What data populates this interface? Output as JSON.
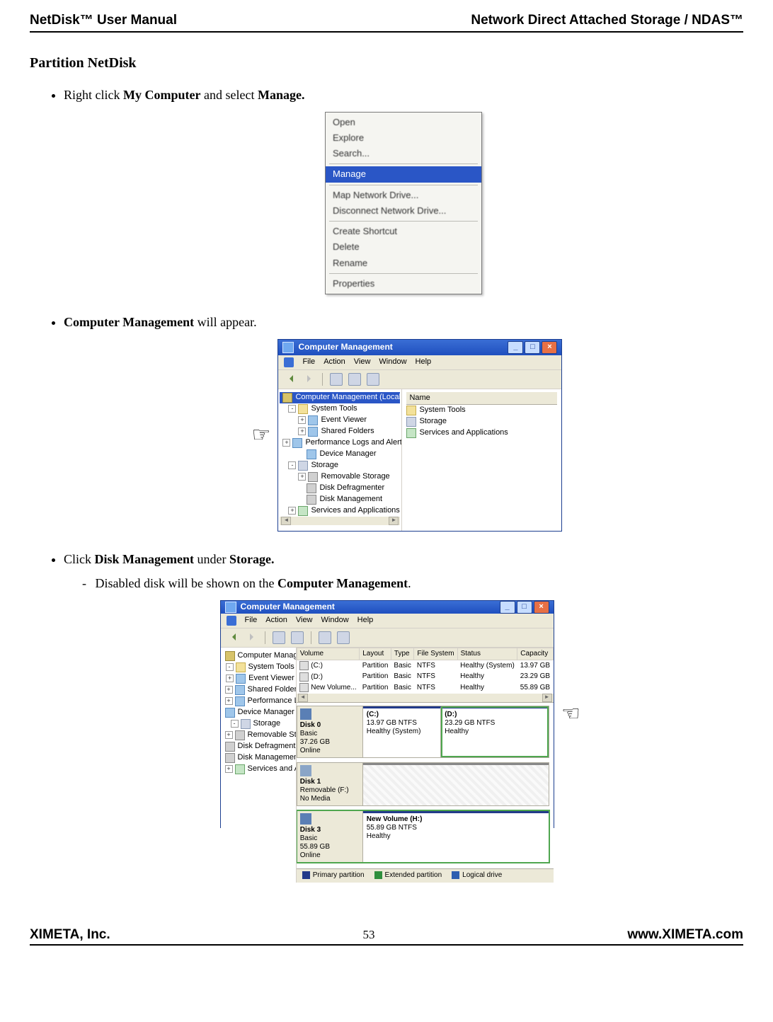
{
  "header": {
    "left": "NetDisk™ User Manual",
    "right": "Network Direct Attached Storage / NDAS™"
  },
  "section_heading": "Partition NetDisk",
  "bullets": {
    "b1_pre": "Right click ",
    "b1_bold1": "My Computer",
    "b1_mid": " and select ",
    "b1_bold2": "Manage.",
    "b2_bold": "Computer Management",
    "b2_post": " will appear.",
    "b3_pre": "Click ",
    "b3_bold1": "Disk Management",
    "b3_mid": " under ",
    "b3_bold2": "Storage.",
    "b3_sub_pre": "Disabled disk will be shown on the ",
    "b3_sub_bold": "Computer Management",
    "b3_sub_post": "."
  },
  "context_menu": {
    "items_top": [
      "Open",
      "Explore",
      "Search..."
    ],
    "selected": "Manage",
    "items_mid": [
      "Map Network Drive...",
      "Disconnect Network Drive..."
    ],
    "items_mid2": [
      "Create Shortcut",
      "Delete",
      "Rename"
    ],
    "items_bot": [
      "Properties"
    ]
  },
  "xp_common": {
    "title": "Computer Management",
    "btn_min": "_",
    "btn_max": "□",
    "btn_close": "×",
    "menus": [
      "File",
      "Action",
      "View",
      "Window",
      "Help"
    ]
  },
  "fig2": {
    "tree_root": "Computer Management (Local)",
    "tree": [
      "System Tools",
      "Event Viewer",
      "Shared Folders",
      "Performance Logs and Alerts",
      "Device Manager",
      "Storage",
      "Removable Storage",
      "Disk Defragmenter",
      "Disk Management",
      "Services and Applications"
    ],
    "list_header": "Name",
    "list": [
      "System Tools",
      "Storage",
      "Services and Applications"
    ]
  },
  "fig3": {
    "tree_root": "Computer Management (Local)",
    "tree": [
      "System Tools",
      "Event Viewer",
      "Shared Folders",
      "Performance Logs and Alerts",
      "Device Manager",
      "Storage",
      "Removable Storage",
      "Disk Defragmenter",
      "Disk Management",
      "Services and Applications"
    ],
    "columns": [
      "Volume",
      "Layout",
      "Type",
      "File System",
      "Status",
      "Capacity"
    ],
    "rows": [
      {
        "vol": "(C:)",
        "layout": "Partition",
        "type": "Basic",
        "fs": "NTFS",
        "status": "Healthy (System)",
        "cap": "13.97 GB"
      },
      {
        "vol": "(D:)",
        "layout": "Partition",
        "type": "Basic",
        "fs": "NTFS",
        "status": "Healthy",
        "cap": "23.29 GB"
      },
      {
        "vol": "New Volume...",
        "layout": "Partition",
        "type": "Basic",
        "fs": "NTFS",
        "status": "Healthy",
        "cap": "55.89 GB"
      }
    ],
    "disks": {
      "d0": {
        "name": "Disk 0",
        "l2": "Basic",
        "l3": "37.26 GB",
        "l4": "Online",
        "p1": {
          "t1": "(C:)",
          "t2": "13.97 GB NTFS",
          "t3": "Healthy (System)"
        },
        "p2": {
          "t1": "(D:)",
          "t2": "23.29 GB NTFS",
          "t3": "Healthy"
        }
      },
      "d1": {
        "name": "Disk 1",
        "l2": "Removable (F:)",
        "l3": "",
        "l4": "No Media"
      },
      "d3": {
        "name": "Disk 3",
        "l2": "Basic",
        "l3": "55.89 GB",
        "l4": "Online",
        "p1": {
          "t1": "New Volume  (H:)",
          "t2": "55.89 GB NTFS",
          "t3": "Healthy"
        }
      }
    },
    "legend": {
      "a": "Primary partition",
      "b": "Extended partition",
      "c": "Logical drive"
    }
  },
  "footer": {
    "left": "XIMETA, Inc.",
    "page": "53",
    "right": "www.XIMETA.com"
  },
  "pointer_glyph": "☞"
}
